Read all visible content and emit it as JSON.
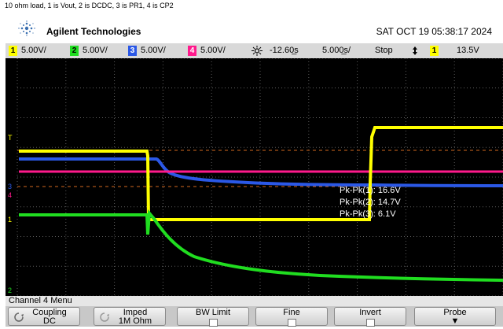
{
  "caption": "10 ohm load, 1 is Vout, 2 is DCDC, 3 is PR1, 4 is CP2",
  "header": {
    "brand": "Agilent Technologies",
    "datetime": "SAT OCT 19 05:38:17 2024"
  },
  "status_bar": {
    "channels": [
      {
        "num": "1",
        "scale": "5.00V/",
        "color": "#ffff00"
      },
      {
        "num": "2",
        "scale": "5.00V/",
        "color": "#20dd20"
      },
      {
        "num": "3",
        "scale": "5.00V/",
        "color": "#2b58e6"
      },
      {
        "num": "4",
        "scale": "5.00V/",
        "color": "#ff1a8c"
      }
    ],
    "trigger_icon": "trigger-icon",
    "time_offset": "-12.60̲s",
    "time_scale": "5.000̲s/",
    "run_state": "Stop",
    "trigger_edge_icon": "trigger-edge-icon",
    "trigger_channel": "1",
    "trigger_level": "13.5V"
  },
  "markers": {
    "trigger": "T",
    "ch3": "3",
    "ch4": "4",
    "ch1": "1",
    "ch2": "2"
  },
  "measurements": [
    {
      "label": "Pk-Pk(1):",
      "value": "16.6V"
    },
    {
      "label": "Pk-Pk(2):",
      "value": "14.7V"
    },
    {
      "label": "Pk-Pk(3):",
      "value": "6.1V"
    }
  ],
  "menu": {
    "title": "Channel 4  Menu",
    "softkeys": [
      {
        "name": "coupling",
        "label": "Coupling",
        "value": "DC"
      },
      {
        "name": "imped",
        "label": "Imped",
        "value": "1M Ohm"
      },
      {
        "name": "bw-limit",
        "label": "BW Limit",
        "value": ""
      },
      {
        "name": "fine",
        "label": "Fine",
        "value": ""
      },
      {
        "name": "invert",
        "label": "Invert",
        "value": ""
      },
      {
        "name": "probe",
        "label": "Probe",
        "value": ""
      }
    ]
  },
  "colors": {
    "ch1": "#ffff00",
    "ch2": "#20dd20",
    "ch3": "#2b58e6",
    "ch4": "#ff1a8c",
    "grid": "#5a5a5a"
  }
}
